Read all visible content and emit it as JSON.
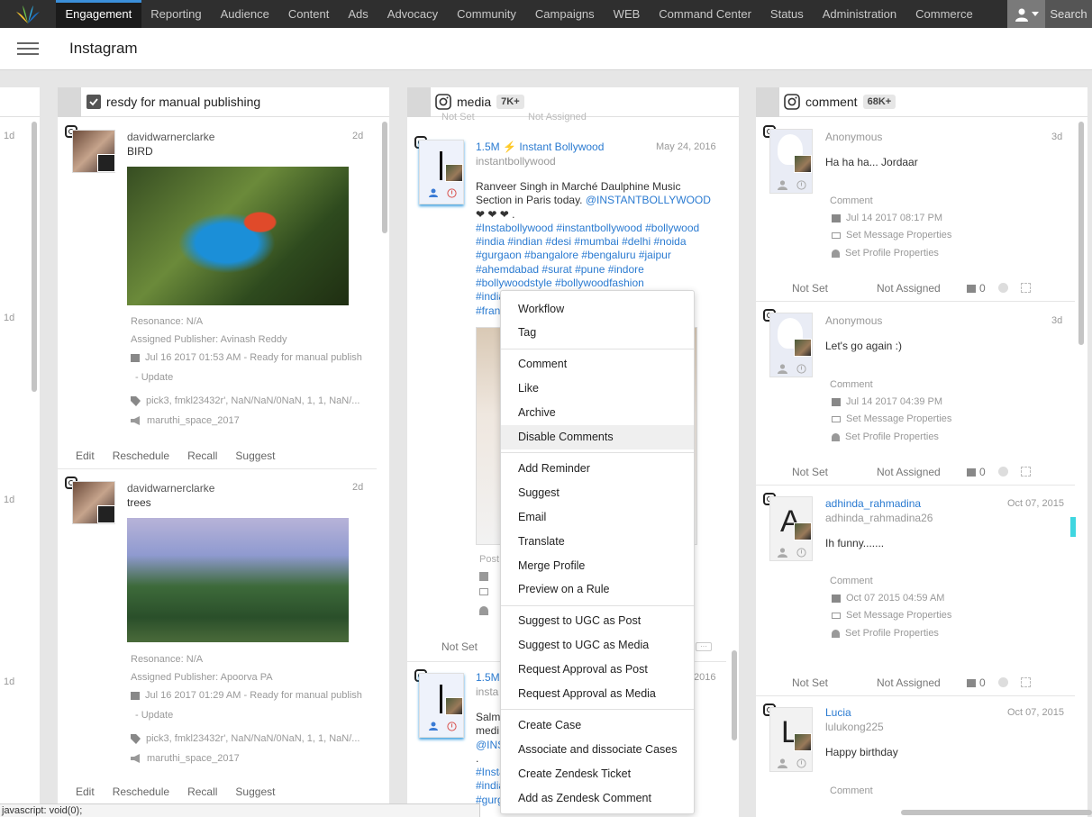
{
  "nav": {
    "items": [
      "Engagement",
      "Reporting",
      "Audience",
      "Content",
      "Ads",
      "Advocacy",
      "Community",
      "Campaigns",
      "WEB",
      "Command Center",
      "Status",
      "Administration",
      "Commerce"
    ],
    "search_label": "Search"
  },
  "header": {
    "title": "Instagram"
  },
  "left_strip": {
    "times": [
      "1d",
      "1d",
      "1d",
      "1d"
    ]
  },
  "col1": {
    "title": "resdy for manual publishing",
    "cards": [
      {
        "user": "davidwarnerclarke",
        "time": "2d",
        "text": "BIRD",
        "resonance": "Resonance:  N/A",
        "assigned": "Assigned Publisher: Avinash Reddy",
        "date": "Jul 16 2017 01:53 AM  -  Ready for manual publish",
        "update": "- Update",
        "tags": "pick3, fmkl23432r', NaN/NaN/0NaN, 1, 1, NaN/...",
        "campaign": "maruthi_space_2017",
        "actions": [
          "Edit",
          "Reschedule",
          "Recall",
          "Suggest"
        ]
      },
      {
        "user": "davidwarnerclarke",
        "time": "2d",
        "text": "trees",
        "resonance": "Resonance:  N/A",
        "assigned": "Assigned Publisher: Apoorva PA",
        "date": "Jul 16 2017 01:29 AM  -  Ready for manual publish",
        "update": "- Update",
        "tags": "pick3, fmkl23432r', NaN/NaN/0NaN, 1, 1, NaN/...",
        "campaign": "maruthi_space_2017",
        "actions": [
          "Edit",
          "Reschedule",
          "Recall",
          "Suggest"
        ]
      }
    ]
  },
  "col2": {
    "title": "media",
    "badge": "7K+",
    "top_partial": {
      "left": "Not Set",
      "right": "Not Assigned"
    },
    "card1": {
      "followers": "1.5M",
      "name": "Instant Bollywood",
      "handle": "instantbollywood",
      "date": "May 24, 2016",
      "text1": "Ranveer Singh in Marché Daulphine Music",
      "text2": "Section in Paris today. ",
      "mention": "@INSTANTBOLLYWOOD",
      "hearts": "❤ ❤ ❤ .",
      "hashtags": [
        "#Instabollywood #instantbollywood #bollywood",
        "#india #indian #desi #mumbai #delhi #noida",
        "#gurgaon #bangalore #bengaluru #jaipur",
        "#ahemdabad #surat #pune #indore",
        "#bollywoodstyle #bollywoodfashion",
        "#india",
        "#fran"
      ],
      "post_label": "Post",
      "footer_left": "Not Set"
    },
    "card2": {
      "followers": "1.5M",
      "date_partial": "2016",
      "handle_partial": "insta",
      "text_partial": [
        "Salm",
        "medi",
        "@INS",
        ".",
        "#Insta",
        "#india",
        "#gurg"
      ]
    }
  },
  "col3": {
    "title": "comment",
    "badge": "68K+",
    "cards": [
      {
        "user": "Anonymous",
        "time": "3d",
        "text": "Ha ha ha... Jordaar",
        "type": "Comment",
        "date": "Jul 14 2017 08:17 PM",
        "msg_props": "Set Message Properties",
        "profile_props": "Set Profile Properties",
        "status": "Not Set",
        "assign": "Not Assigned",
        "count": "0"
      },
      {
        "user": "Anonymous",
        "time": "3d",
        "text": "Let's go again :)",
        "type": "Comment",
        "date": "Jul 14 2017 04:39 PM",
        "msg_props": "Set Message Properties",
        "profile_props": "Set Profile Properties",
        "status": "Not Set",
        "assign": "Not Assigned",
        "count": "0"
      },
      {
        "user": "adhinda_rahmadina",
        "handle": "adhinda_rahmadina26",
        "letter": "A",
        "time": "Oct 07, 2015",
        "text": "Ih funny.......",
        "type": "Comment",
        "date": "Oct 07 2015 04:59 AM",
        "msg_props": "Set Message Properties",
        "profile_props": "Set Profile Properties",
        "status": "Not Set",
        "assign": "Not Assigned",
        "count": "0"
      },
      {
        "user": "Lucia",
        "handle": "lulukong225",
        "letter": "L",
        "time": "Oct 07, 2015",
        "text": "Happy birthday",
        "type": "Comment"
      }
    ]
  },
  "context_menu": {
    "groups": [
      [
        "Workflow",
        "Tag"
      ],
      [
        "Comment",
        "Like",
        "Archive",
        "Disable Comments"
      ],
      [
        "Add Reminder",
        "Suggest",
        "Email",
        "Translate",
        "Merge Profile",
        "Preview on a Rule"
      ],
      [
        "Suggest to UGC as Post",
        "Suggest to UGC as Media",
        "Request Approval as Post",
        "Request Approval as Media"
      ],
      [
        "Create Case",
        "Associate and dissociate Cases",
        "Create Zendesk Ticket",
        "Add as Zendesk Comment"
      ]
    ],
    "hovered": "Disable Comments"
  },
  "statusbar": {
    "text": "javascript: void(0);"
  },
  "colors": {
    "accent": "#3b8fd9",
    "link": "#2b7bd1",
    "nav_bg": "#2f2f2f",
    "cyan_marker": "#3fd6e0"
  }
}
